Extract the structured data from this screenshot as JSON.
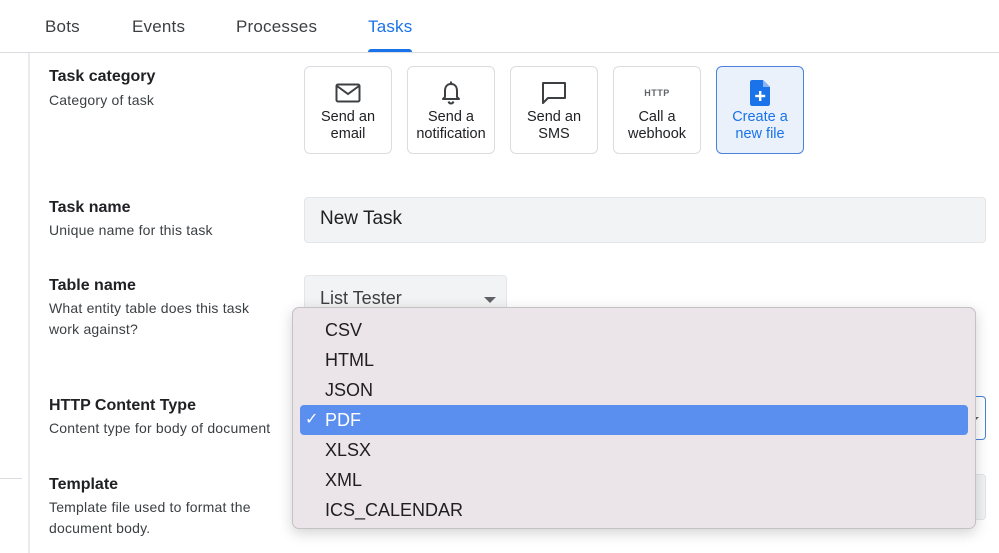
{
  "tabs": [
    {
      "label": "Bots",
      "active": false
    },
    {
      "label": "Events",
      "active": false
    },
    {
      "label": "Processes",
      "active": false
    },
    {
      "label": "Tasks",
      "active": true
    }
  ],
  "task_category": {
    "title": "Task category",
    "desc": "Category of task",
    "options": [
      {
        "icon": "email-icon",
        "label": "Send an\nemail",
        "selected": false
      },
      {
        "icon": "bell-icon",
        "label": "Send a\nnotification",
        "selected": false
      },
      {
        "icon": "chat-icon",
        "label": "Send an\nSMS",
        "selected": false
      },
      {
        "icon": "http-icon",
        "icon_text": "HTTP",
        "label": "Call a\nwebhook",
        "selected": false
      },
      {
        "icon": "new-file-icon",
        "label": "Create a\nnew file",
        "selected": true
      }
    ]
  },
  "task_name": {
    "title": "Task name",
    "desc": "Unique name for this task",
    "value": "New Task"
  },
  "table_name": {
    "title": "Table name",
    "desc": "What entity table does this task\nwork against?",
    "value": "List Tester"
  },
  "http_content_type": {
    "title": "HTTP Content Type",
    "desc": "Content type for body of document",
    "options": [
      "CSV",
      "HTML",
      "JSON",
      "PDF",
      "XLSX",
      "XML",
      "ICS_CALENDAR"
    ],
    "selected": "PDF",
    "check_mark": "✓"
  },
  "template": {
    "title": "Template",
    "desc": "Template file used to format the\ndocument body."
  },
  "colors": {
    "accent": "#1a73e8",
    "selected_option": "#5a8ff0",
    "popup_bg": "#ebe4e8",
    "input_bg": "#f1f3f4"
  }
}
